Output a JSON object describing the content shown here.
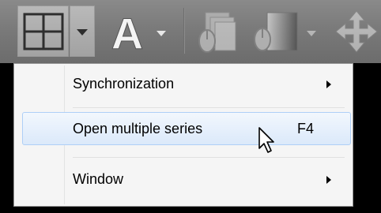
{
  "toolbar": {
    "buttons": [
      {
        "name": "layout",
        "icon": "grid-layout-icon",
        "state": "pressed"
      },
      {
        "name": "layout-dropdown",
        "icon": "chevron-down-icon",
        "state": "pressed"
      },
      {
        "name": "annotations",
        "icon": "letter-a-icon",
        "glyph": "A"
      },
      {
        "name": "annotations-dropdown",
        "icon": "chevron-down-icon"
      },
      {
        "name": "stack",
        "icon": "stack-series-icon",
        "state": "disabled"
      },
      {
        "name": "window-level",
        "icon": "contrast-mouse-icon",
        "state": "disabled"
      },
      {
        "name": "window-level-dropdown",
        "icon": "chevron-down-icon",
        "state": "disabled"
      },
      {
        "name": "pan",
        "icon": "move-arrows-icon",
        "state": "disabled"
      }
    ]
  },
  "menu": {
    "items": [
      {
        "label": "Synchronization",
        "shortcut": "",
        "submenu": true
      },
      {
        "label": "Open multiple series",
        "shortcut": "F4",
        "submenu": false,
        "highlighted": true
      },
      {
        "label": "Window",
        "shortcut": "",
        "submenu": true
      }
    ]
  },
  "colors": {
    "toolbar_bg": "#7a7a7a",
    "menu_bg": "#f5f5f5",
    "highlight_border": "#aecff7",
    "highlight_bg": "#dbe9fa"
  }
}
